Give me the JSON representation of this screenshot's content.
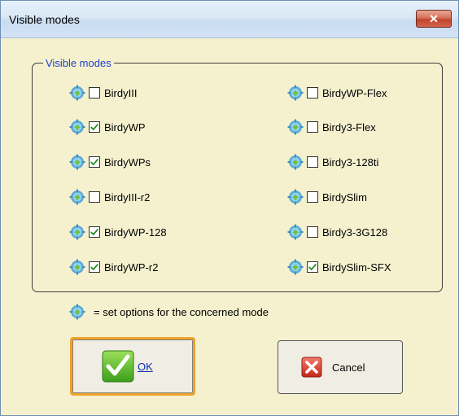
{
  "window": {
    "title": "Visible modes",
    "close_glyph": "✕"
  },
  "group": {
    "label": "Visible modes"
  },
  "modes_left": [
    {
      "label": "BirdyIII",
      "checked": false
    },
    {
      "label": "BirdyWP",
      "checked": true
    },
    {
      "label": "BirdyWPs",
      "checked": true
    },
    {
      "label": "BirdyIII-r2",
      "checked": false
    },
    {
      "label": "BirdyWP-128",
      "checked": true
    },
    {
      "label": "BirdyWP-r2",
      "checked": true
    }
  ],
  "modes_right": [
    {
      "label": "BirdyWP-Flex",
      "checked": false
    },
    {
      "label": "Birdy3-Flex",
      "checked": false
    },
    {
      "label": "Birdy3-128ti",
      "checked": false
    },
    {
      "label": "BirdySlim",
      "checked": false
    },
    {
      "label": "Birdy3-3G128",
      "checked": false
    },
    {
      "label": "BirdySlim-SFX",
      "checked": true
    }
  ],
  "legend": {
    "text": "= set options for the concerned mode",
    "icon": "gear-options-icon"
  },
  "buttons": {
    "ok_label": "OK",
    "cancel_label": "Cancel"
  },
  "colors": {
    "background": "#f5f1cf",
    "group_label": "#1e40c8",
    "ok_focus_border": "#f0a32b",
    "close_button": "#c1432b"
  }
}
